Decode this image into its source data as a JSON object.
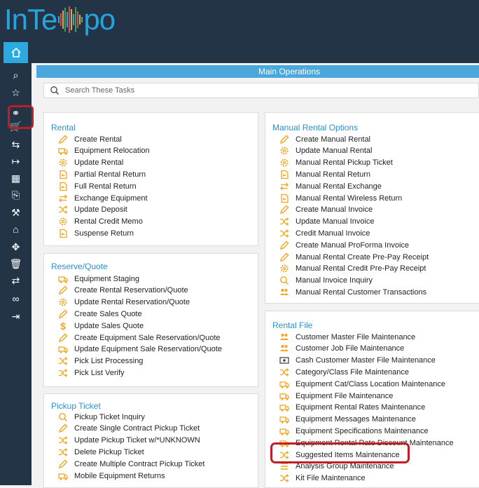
{
  "app": {
    "logo_left": "InTe",
    "logo_right": "po",
    "logo_bar_colors": [
      "#2da9e1",
      "#e24b4b",
      "#f2a51c",
      "#29a36a",
      "#2da9e1",
      "#e24b4b",
      "#f2a51c",
      "#2da9e1",
      "#29a36a",
      "#e24b4b",
      "#f2a51c",
      "#2da9e1"
    ]
  },
  "sidebar": {
    "items": [
      {
        "icon": "search-icon",
        "glyph": "⌕"
      },
      {
        "icon": "star-icon",
        "glyph": "☆"
      },
      {
        "icon": "link-icon",
        "glyph": "⚭",
        "selected": true
      },
      {
        "icon": "cart-icon",
        "glyph": "🛒"
      },
      {
        "icon": "return-icon",
        "glyph": "⇆"
      },
      {
        "icon": "forward-icon",
        "glyph": "↦"
      },
      {
        "icon": "calculator-icon",
        "glyph": "▦"
      },
      {
        "icon": "document-search-icon",
        "glyph": "⎘"
      },
      {
        "icon": "wrench-icon",
        "glyph": "⚒"
      },
      {
        "icon": "lock-icon",
        "glyph": "⌂"
      },
      {
        "icon": "move-icon",
        "glyph": "✥"
      },
      {
        "icon": "trash-icon",
        "glyph": "🗑"
      },
      {
        "icon": "transfer-icon",
        "glyph": "⇄"
      },
      {
        "icon": "glasses-icon",
        "glyph": "∞"
      },
      {
        "icon": "logout-icon",
        "glyph": "⇥"
      }
    ]
  },
  "header": {
    "title": "Main Operations"
  },
  "search": {
    "placeholder": "Search These Tasks"
  },
  "colors": {
    "accent": "#4ba8dc",
    "icon": "#f2a51c",
    "highlight": "#c11d24",
    "sidebar": "#243447"
  },
  "panels": {
    "rental": {
      "title": "Rental",
      "items": [
        {
          "icon": "pencil-icon",
          "label": "Create Rental"
        },
        {
          "icon": "truck-icon",
          "label": "Equipment Relocation"
        },
        {
          "icon": "gear-icon",
          "label": "Update Rental"
        },
        {
          "icon": "return-doc-icon",
          "label": "Partial Rental Return"
        },
        {
          "icon": "return-doc-icon",
          "label": "Full Rental Return"
        },
        {
          "icon": "exchange-icon",
          "label": "Exchange Equipment"
        },
        {
          "icon": "shuffle-icon",
          "label": "Update Deposit"
        },
        {
          "icon": "gear-icon",
          "label": "Rental Credit Memo"
        },
        {
          "icon": "return-doc-icon",
          "label": "Suspense Return"
        }
      ]
    },
    "reserve": {
      "title": "Reserve/Quote",
      "items": [
        {
          "icon": "truck-icon",
          "label": "Equipment Staging"
        },
        {
          "icon": "pencil-icon",
          "label": "Create Rental Reservation/Quote"
        },
        {
          "icon": "gear-icon",
          "label": "Update Rental Reservation/Quote"
        },
        {
          "icon": "pencil-icon",
          "label": "Create Sales Quote"
        },
        {
          "icon": "dollar-icon",
          "label": "Update Sales Quote"
        },
        {
          "icon": "pencil-icon",
          "label": "Create Equipment Sale Reservation/Quote"
        },
        {
          "icon": "truck-icon",
          "label": "Update Equipment Sale Reservation/Quote"
        },
        {
          "icon": "shuffle-icon",
          "label": "Pick List Processing"
        },
        {
          "icon": "shuffle-icon",
          "label": "Pick List Verify"
        }
      ]
    },
    "pickup": {
      "title": "Pickup Ticket",
      "items": [
        {
          "icon": "search-icon",
          "label": "Pickup Ticket Inquiry"
        },
        {
          "icon": "pencil-icon",
          "label": "Create Single Contract Pickup Ticket"
        },
        {
          "icon": "shuffle-icon",
          "label": "Update Pickup Ticket w/*UNKNOWN"
        },
        {
          "icon": "shuffle-icon",
          "label": "Delete Pickup Ticket"
        },
        {
          "icon": "pencil-icon",
          "label": "Create Multiple Contract Pickup Ticket"
        },
        {
          "icon": "truck-icon",
          "label": "Mobile Equipment Returns"
        }
      ]
    },
    "manual": {
      "title": "Manual Rental Options",
      "items": [
        {
          "icon": "pencil-icon",
          "label": "Create Manual Rental"
        },
        {
          "icon": "gear-icon",
          "label": "Update Manual Rental"
        },
        {
          "icon": "gear-icon",
          "label": "Manual Rental Pickup Ticket"
        },
        {
          "icon": "return-doc-icon",
          "label": "Manual Rental Return"
        },
        {
          "icon": "exchange-icon",
          "label": "Manual Rental Exchange"
        },
        {
          "icon": "return-doc-icon",
          "label": "Manual Rental Wireless Return"
        },
        {
          "icon": "pencil-icon",
          "label": "Create Manual Invoice"
        },
        {
          "icon": "shuffle-icon",
          "label": "Update Manual Invoice"
        },
        {
          "icon": "shuffle-icon",
          "label": "Credit Manual Invoice"
        },
        {
          "icon": "pencil-icon",
          "label": "Create Manual ProForma Invoice"
        },
        {
          "icon": "pencil-icon",
          "label": "Manual Rental Create Pre-Pay Receipt"
        },
        {
          "icon": "gear-icon",
          "label": "Manual Rental Credit Pre-Pay Receipt"
        },
        {
          "icon": "search-icon",
          "label": "Manual Invoice Inquiry"
        },
        {
          "icon": "people-icon",
          "label": "Manual Rental Customer Transactions"
        }
      ]
    },
    "rentalfile": {
      "title": "Rental File",
      "items": [
        {
          "icon": "people-icon",
          "label": "Customer Master File Maintenance"
        },
        {
          "icon": "people-icon",
          "label": "Customer Job File Maintenance"
        },
        {
          "icon": "cash-icon",
          "label": "Cash Customer Master File Maintenance"
        },
        {
          "icon": "shuffle-icon",
          "label": "Category/Class File Maintenance"
        },
        {
          "icon": "truck-icon",
          "label": "Equipment Cat/Class Location Maintenance"
        },
        {
          "icon": "truck-icon",
          "label": "Equipment File Maintenance"
        },
        {
          "icon": "truck-icon",
          "label": "Equipment Rental Rates Maintenance"
        },
        {
          "icon": "truck-icon",
          "label": "Equipment Messages Maintenance"
        },
        {
          "icon": "truck-icon",
          "label": "Equipment Specifications Maintenance"
        },
        {
          "icon": "truck-icon",
          "label": "Equipment Rental Rate Discount Maintenance"
        },
        {
          "icon": "shuffle-icon",
          "label": "Suggested Items Maintenance"
        },
        {
          "icon": "list-icon",
          "label": "Analysis Group Maintenance"
        },
        {
          "icon": "shuffle-icon",
          "label": "Kit File Maintenance"
        }
      ]
    }
  }
}
